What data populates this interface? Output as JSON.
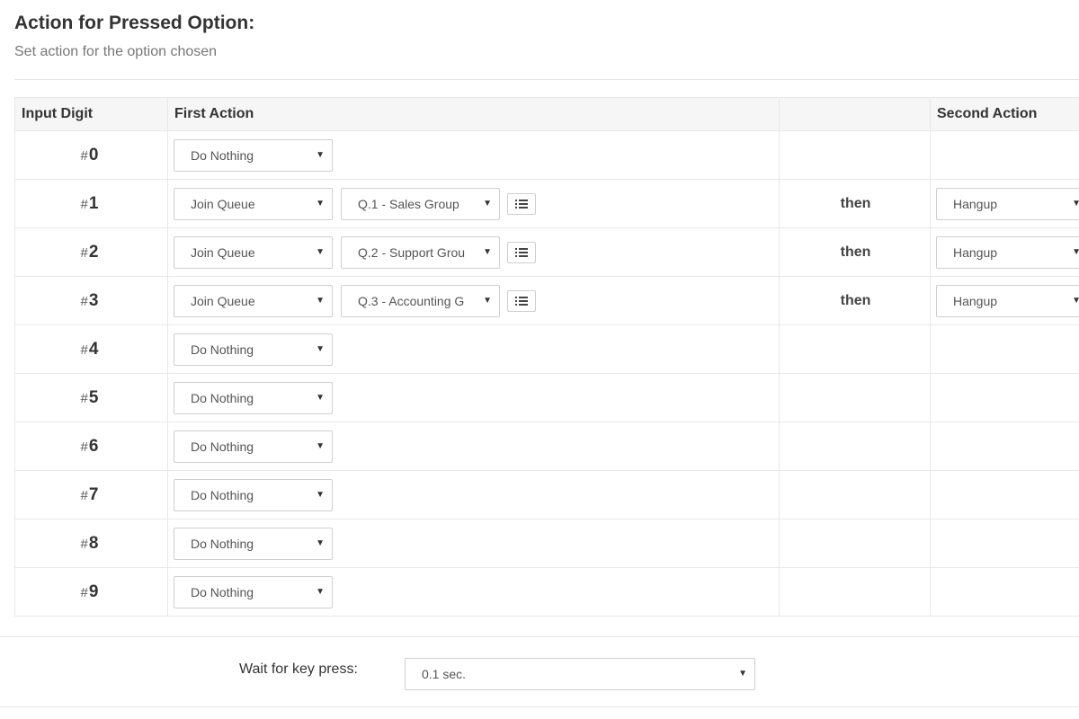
{
  "header": {
    "title": "Action for Pressed Option:",
    "subtitle": "Set action for the option chosen"
  },
  "table": {
    "columns": [
      "Input Digit",
      "First Action",
      "",
      "Second Action"
    ],
    "rows": [
      {
        "hash": "#",
        "digit": "0",
        "first_action": "Do Nothing",
        "queue": "",
        "then": "",
        "second_action": ""
      },
      {
        "hash": "#",
        "digit": "1",
        "first_action": "Join Queue",
        "queue": "Q.1 - Sales Group",
        "then": "then",
        "second_action": "Hangup"
      },
      {
        "hash": "#",
        "digit": "2",
        "first_action": "Join Queue",
        "queue": "Q.2 - Support Grou",
        "then": "then",
        "second_action": "Hangup"
      },
      {
        "hash": "#",
        "digit": "3",
        "first_action": "Join Queue",
        "queue": "Q.3 - Accounting G",
        "then": "then",
        "second_action": "Hangup"
      },
      {
        "hash": "#",
        "digit": "4",
        "first_action": "Do Nothing",
        "queue": "",
        "then": "",
        "second_action": ""
      },
      {
        "hash": "#",
        "digit": "5",
        "first_action": "Do Nothing",
        "queue": "",
        "then": "",
        "second_action": ""
      },
      {
        "hash": "#",
        "digit": "6",
        "first_action": "Do Nothing",
        "queue": "",
        "then": "",
        "second_action": ""
      },
      {
        "hash": "#",
        "digit": "7",
        "first_action": "Do Nothing",
        "queue": "",
        "then": "",
        "second_action": ""
      },
      {
        "hash": "#",
        "digit": "8",
        "first_action": "Do Nothing",
        "queue": "",
        "then": "",
        "second_action": ""
      },
      {
        "hash": "#",
        "digit": "9",
        "first_action": "Do Nothing",
        "queue": "",
        "then": "",
        "second_action": ""
      }
    ]
  },
  "wait": {
    "label": "Wait for key press:",
    "value": "0.1 sec."
  },
  "icons": {
    "caret": "caret-down-icon",
    "list": "list-icon"
  },
  "colors": {
    "header_bg": "#f6f6f6",
    "border": "#e8e8e8",
    "title": "#333333",
    "subtitle": "#777777"
  }
}
